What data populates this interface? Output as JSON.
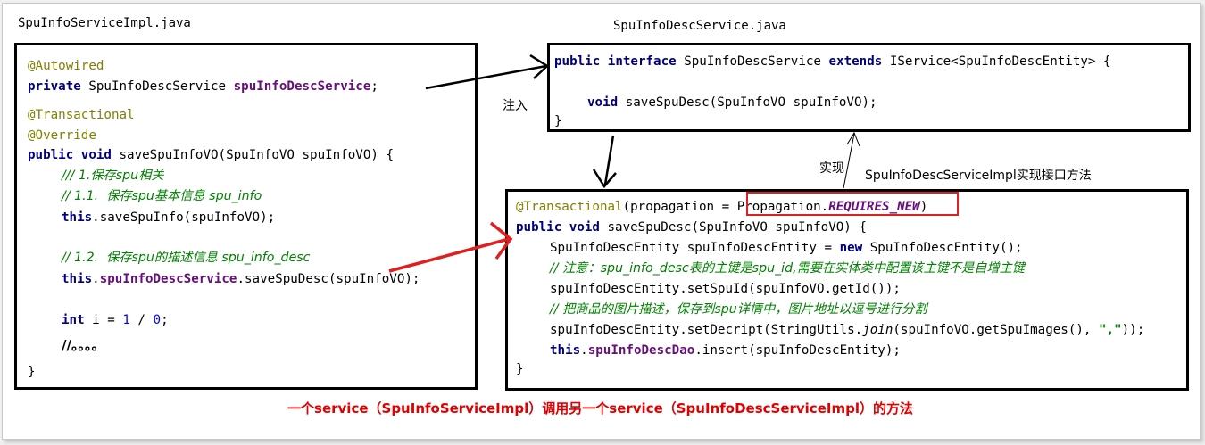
{
  "labels": {
    "left_file": "SpuInfoServiceImpl.java",
    "right_file": "SpuInfoDescService.java",
    "inject": "注入",
    "implement": "实现",
    "impl_note": "SpuInfoDescServiceImpl实现接口方法"
  },
  "left_code": {
    "l1": "@Autowired",
    "l2_kw": "private",
    "l2_type": " SpuInfoDescService ",
    "l2_field": "spuInfoDescService",
    "l2_end": ";",
    "l3": "@Transactional",
    "l4": "@Override",
    "l5_kw1": "public",
    "l5_kw2": " void",
    "l5_rest": " saveSpuInfoVO(SpuInfoVO spuInfoVO) {",
    "l6": "/// 1.保存spu相关",
    "l7": "// 1.1.  保存spu基本信息 spu_info",
    "l8_kw": "this",
    "l8_rest": ".saveSpuInfo(spuInfoVO);",
    "l9": "// 1.2.  保存spu的描述信息 spu_info_desc",
    "l10_kw": "this",
    "l10_dot": ".",
    "l10_field": "spuInfoDescService",
    "l10_rest": ".saveSpuDesc(spuInfoVO);",
    "l11_kw": "int",
    "l11_mid": " i = ",
    "l11_n1": "1",
    "l11_div": " / ",
    "l11_n2": "0",
    "l11_end": ";",
    "l12": "//。。。。",
    "l13": "}"
  },
  "interface_code": {
    "l1_kw1": "public",
    "l1_kw2": " interface",
    "l1_name": " SpuInfoDescService ",
    "l1_kw3": "extends",
    "l1_rest": " IService<SpuInfoDescEntity> {",
    "l2_kw": "void",
    "l2_rest": " saveSpuDesc(SpuInfoVO spuInfoVO);",
    "l3": "}"
  },
  "impl_code": {
    "l1_anno": "@Transactional",
    "l1_mid": "(propagation = ",
    "l1_cls": "Propagation.",
    "l1_const": "REQUIRES_NEW",
    "l1_end": ")",
    "l2_kw1": "public",
    "l2_kw2": " void",
    "l2_rest": " saveSpuDesc(SpuInfoVO spuInfoVO) {",
    "l3_a": "SpuInfoDescEntity spuInfoDescEntity = ",
    "l3_kw": "new",
    "l3_b": " SpuInfoDescEntity();",
    "l4": "// 注意：spu_info_desc表的主键是spu_id,需要在实体类中配置该主键不是自增主键",
    "l5": "spuInfoDescEntity.setSpuId(spuInfoVO.getId());",
    "l6": "// 把商品的图片描述，保存到spu详情中，图片地址以逗号进行分割",
    "l7_a": "spuInfoDescEntity.setDecript(StringUtils.",
    "l7_join": "join",
    "l7_b": "(spuInfoVO.getSpuImages(), ",
    "l7_str": "\",\"",
    "l7_end": "));",
    "l8_kw": "this",
    "l8_dot": ".",
    "l8_field": "spuInfoDescDao",
    "l8_rest": ".insert(spuInfoDescEntity);",
    "l9": "}"
  },
  "caption": "一个service（SpuInfoServiceImpl）调用另一个service（SpuInfoDescServiceImpl）的方法",
  "colors": {
    "annotation": "#808000",
    "keyword": "#000080",
    "field": "#660e7a",
    "comment": "#008000",
    "number": "#0000ff",
    "highlight": "#e02020",
    "caption": "#e00000"
  }
}
